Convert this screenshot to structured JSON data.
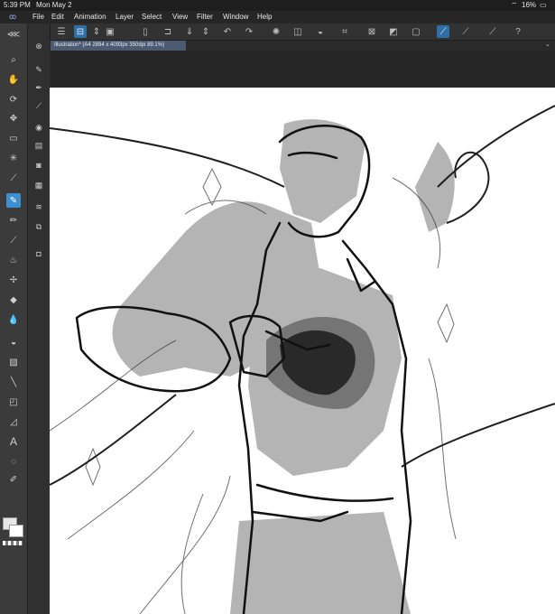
{
  "status": {
    "time": "5:39 PM",
    "date": "Mon May 2",
    "battery": "16%"
  },
  "menu": [
    "File",
    "Edit",
    "Animation",
    "Layer",
    "Select",
    "View",
    "Filter",
    "Window",
    "Help"
  ],
  "document_tab": {
    "label": "Illustration* (A4 2894 x 4093px 350dpi 89.1%)"
  },
  "toolbar_icons": [
    "menu-icon",
    "new-canvas-icon",
    "stepper-icon",
    "gallery-icon",
    "new-file-icon",
    "open-file-icon",
    "save-icon",
    "stepper-icon",
    "undo-icon",
    "redo-icon",
    "loading-icon",
    "clear-icon",
    "fill-icon",
    "transform-icon",
    "deselect-icon",
    "invert-icon",
    "select-layer-icon",
    "stabilize-icon",
    "perspective-icon",
    "ruler-icon",
    "help-icon"
  ],
  "tools": [
    "zoom-icon",
    "hand-icon",
    "rotate-icon",
    "move-icon",
    "select-icon",
    "magic-wand-icon",
    "eyedropper-icon",
    "pen-icon",
    "pencil-icon",
    "brush-icon",
    "airbrush-icon",
    "decoration-icon",
    "eraser-icon",
    "blend-icon",
    "fill-icon",
    "gradient-icon",
    "line-icon",
    "frame-icon",
    "text-icon",
    "balloon-icon",
    "correction-icon"
  ],
  "sub_tools": [
    "close-icon",
    "pen-icon",
    "ink-icon",
    "brush-icon",
    "layers-icon",
    "layers-icon",
    "camera-icon",
    "fill-icon",
    "layers-icon",
    "layers-icon",
    "layers-icon"
  ],
  "colors": {
    "accent": "#3d8fd0",
    "toolbar_bg": "#323232",
    "canvas_bg": "#262626",
    "paper": "#ffffff"
  }
}
